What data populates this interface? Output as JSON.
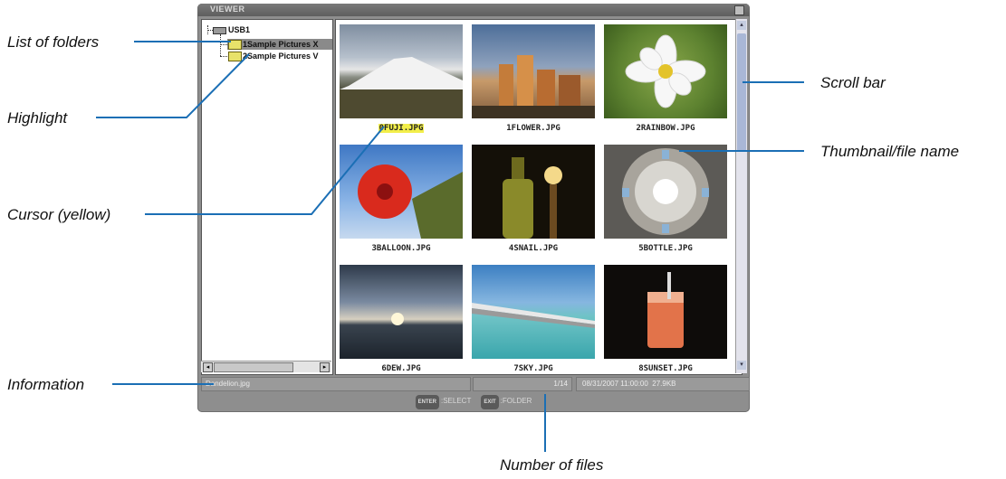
{
  "callouts": {
    "list_of_folders": "List of folders",
    "highlight": "Highlight",
    "cursor": "Cursor (yellow)",
    "information": "Information",
    "scroll_bar": "Scroll bar",
    "thumbnail_file_name": "Thumbnail/file name",
    "number_of_files": "Number of files"
  },
  "window": {
    "title": "VIEWER"
  },
  "tree": {
    "drive": "USB1",
    "folders": [
      "1Sample Pictures X",
      "2Sample Pictures V"
    ],
    "selected_index": 0
  },
  "thumbnails": [
    {
      "name": "0FUJI.JPG",
      "cursor": true
    },
    {
      "name": "1FLOWER.JPG",
      "cursor": false
    },
    {
      "name": "2RAINBOW.JPG",
      "cursor": false
    },
    {
      "name": "3BALLOON.JPG",
      "cursor": false
    },
    {
      "name": "4SNAIL.JPG",
      "cursor": false
    },
    {
      "name": "5BOTTLE.JPG",
      "cursor": false
    },
    {
      "name": "6DEW.JPG",
      "cursor": false
    },
    {
      "name": "7SKY.JPG",
      "cursor": false
    },
    {
      "name": "8SUNSET.JPG",
      "cursor": false
    }
  ],
  "info": {
    "filename": "Dandelion.jpg",
    "file_count": "1/14",
    "datetime": "08/31/2007 11:00:00",
    "size": "27.9KB"
  },
  "footer": {
    "select_key": "ENTER",
    "select_label": ":SELECT",
    "folder_key": "EXIT",
    "folder_label": ":FOLDER"
  },
  "colors": {
    "cursor": "#f2ee4a",
    "highlight": "#8a8a8a",
    "leader_line": "#1b6fb5"
  }
}
